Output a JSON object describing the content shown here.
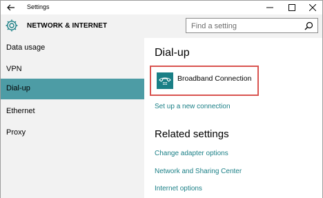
{
  "window": {
    "title": "Settings"
  },
  "header": {
    "section_title": "NETWORK & INTERNET",
    "search_placeholder": "Find a setting"
  },
  "sidebar": {
    "items": [
      {
        "label": "Data usage",
        "selected": false
      },
      {
        "label": "VPN",
        "selected": false
      },
      {
        "label": "Dial-up",
        "selected": true
      },
      {
        "label": "Ethernet",
        "selected": false
      },
      {
        "label": "Proxy",
        "selected": false
      }
    ]
  },
  "main": {
    "title": "Dial-up",
    "connection": {
      "label": "Broadband Connection",
      "icon": "dialup-phone-icon"
    },
    "setup_link": "Set up a new connection",
    "related_title": "Related settings",
    "related_links": [
      "Change adapter options",
      "Network and Sharing Center",
      "Internet options"
    ]
  },
  "colors": {
    "accent": "#1a7f86",
    "selected": "#4d9ca5",
    "highlight_border": "#d9534f",
    "panel": "#f2f2f2"
  }
}
